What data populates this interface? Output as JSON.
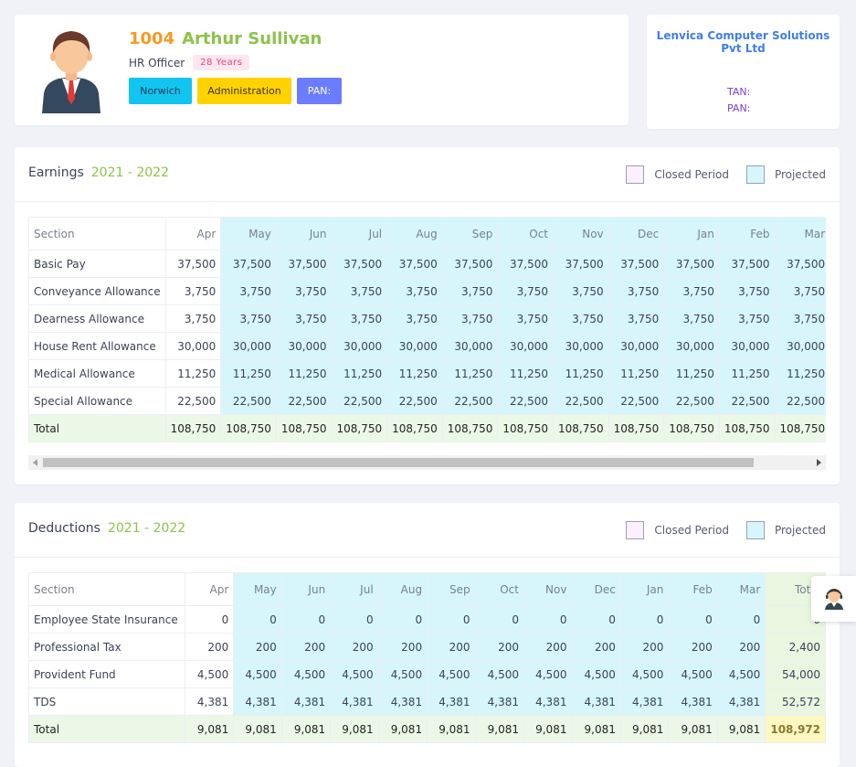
{
  "employee": {
    "id": "1004",
    "name": "Arthur Sullivan",
    "designation": "HR Officer",
    "age": "28 Years",
    "location": "Norwich",
    "department": "Administration",
    "pan_tag": "PAN:"
  },
  "company": {
    "name": "Lenvica Computer Solutions Pvt Ltd",
    "tan_label": "TAN:",
    "pan_label": "PAN:"
  },
  "legend": {
    "closed": "Closed Period",
    "projected": "Projected"
  },
  "earnings": {
    "title": "Earnings",
    "year": "2021 - 2022",
    "columns": [
      "Section",
      "Apr",
      "May",
      "Jun",
      "Jul",
      "Aug",
      "Sep",
      "Oct",
      "Nov",
      "Dec",
      "Jan",
      "Feb",
      "Mar"
    ],
    "rows": [
      {
        "label": "Basic Pay",
        "values": [
          "37,500",
          "37,500",
          "37,500",
          "37,500",
          "37,500",
          "37,500",
          "37,500",
          "37,500",
          "37,500",
          "37,500",
          "37,500",
          "37,500"
        ]
      },
      {
        "label": "Conveyance Allowance",
        "values": [
          "3,750",
          "3,750",
          "3,750",
          "3,750",
          "3,750",
          "3,750",
          "3,750",
          "3,750",
          "3,750",
          "3,750",
          "3,750",
          "3,750"
        ]
      },
      {
        "label": "Dearness Allowance",
        "values": [
          "3,750",
          "3,750",
          "3,750",
          "3,750",
          "3,750",
          "3,750",
          "3,750",
          "3,750",
          "3,750",
          "3,750",
          "3,750",
          "3,750"
        ]
      },
      {
        "label": "House Rent Allowance",
        "values": [
          "30,000",
          "30,000",
          "30,000",
          "30,000",
          "30,000",
          "30,000",
          "30,000",
          "30,000",
          "30,000",
          "30,000",
          "30,000",
          "30,000"
        ]
      },
      {
        "label": "Medical Allowance",
        "values": [
          "11,250",
          "11,250",
          "11,250",
          "11,250",
          "11,250",
          "11,250",
          "11,250",
          "11,250",
          "11,250",
          "11,250",
          "11,250",
          "11,250"
        ]
      },
      {
        "label": "Special Allowance",
        "values": [
          "22,500",
          "22,500",
          "22,500",
          "22,500",
          "22,500",
          "22,500",
          "22,500",
          "22,500",
          "22,500",
          "22,500",
          "22,500",
          "22,500"
        ]
      }
    ],
    "total": {
      "label": "Total",
      "values": [
        "108,750",
        "108,750",
        "108,750",
        "108,750",
        "108,750",
        "108,750",
        "108,750",
        "108,750",
        "108,750",
        "108,750",
        "108,750",
        "108,750"
      ],
      "peek": "1"
    }
  },
  "deductions": {
    "title": "Deductions",
    "year": "2021 - 2022",
    "columns": [
      "Section",
      "Apr",
      "May",
      "Jun",
      "Jul",
      "Aug",
      "Sep",
      "Oct",
      "Nov",
      "Dec",
      "Jan",
      "Feb",
      "Mar",
      "Total"
    ],
    "rows": [
      {
        "label": "Employee State Insurance",
        "values": [
          "0",
          "0",
          "0",
          "0",
          "0",
          "0",
          "0",
          "0",
          "0",
          "0",
          "0",
          "0"
        ],
        "total": "0"
      },
      {
        "label": "Professional Tax",
        "values": [
          "200",
          "200",
          "200",
          "200",
          "200",
          "200",
          "200",
          "200",
          "200",
          "200",
          "200",
          "200"
        ],
        "total": "2,400"
      },
      {
        "label": "Provident Fund",
        "values": [
          "4,500",
          "4,500",
          "4,500",
          "4,500",
          "4,500",
          "4,500",
          "4,500",
          "4,500",
          "4,500",
          "4,500",
          "4,500",
          "4,500"
        ],
        "total": "54,000"
      },
      {
        "label": "TDS",
        "values": [
          "4,381",
          "4,381",
          "4,381",
          "4,381",
          "4,381",
          "4,381",
          "4,381",
          "4,381",
          "4,381",
          "4,381",
          "4,381",
          "4,381"
        ],
        "total": "52,572"
      }
    ],
    "total": {
      "label": "Total",
      "values": [
        "9,081",
        "9,081",
        "9,081",
        "9,081",
        "9,081",
        "9,081",
        "9,081",
        "9,081",
        "9,081",
        "9,081",
        "9,081",
        "9,081"
      ],
      "total": "108,972"
    }
  },
  "colors": {
    "projected": "#d6f6fc",
    "closed": "#fdeffd",
    "accent_green": "#8bc34a",
    "accent_orange": "#f59a23"
  },
  "icons": {
    "avatar": "male-employee-avatar-icon",
    "support": "support-agent-icon"
  }
}
